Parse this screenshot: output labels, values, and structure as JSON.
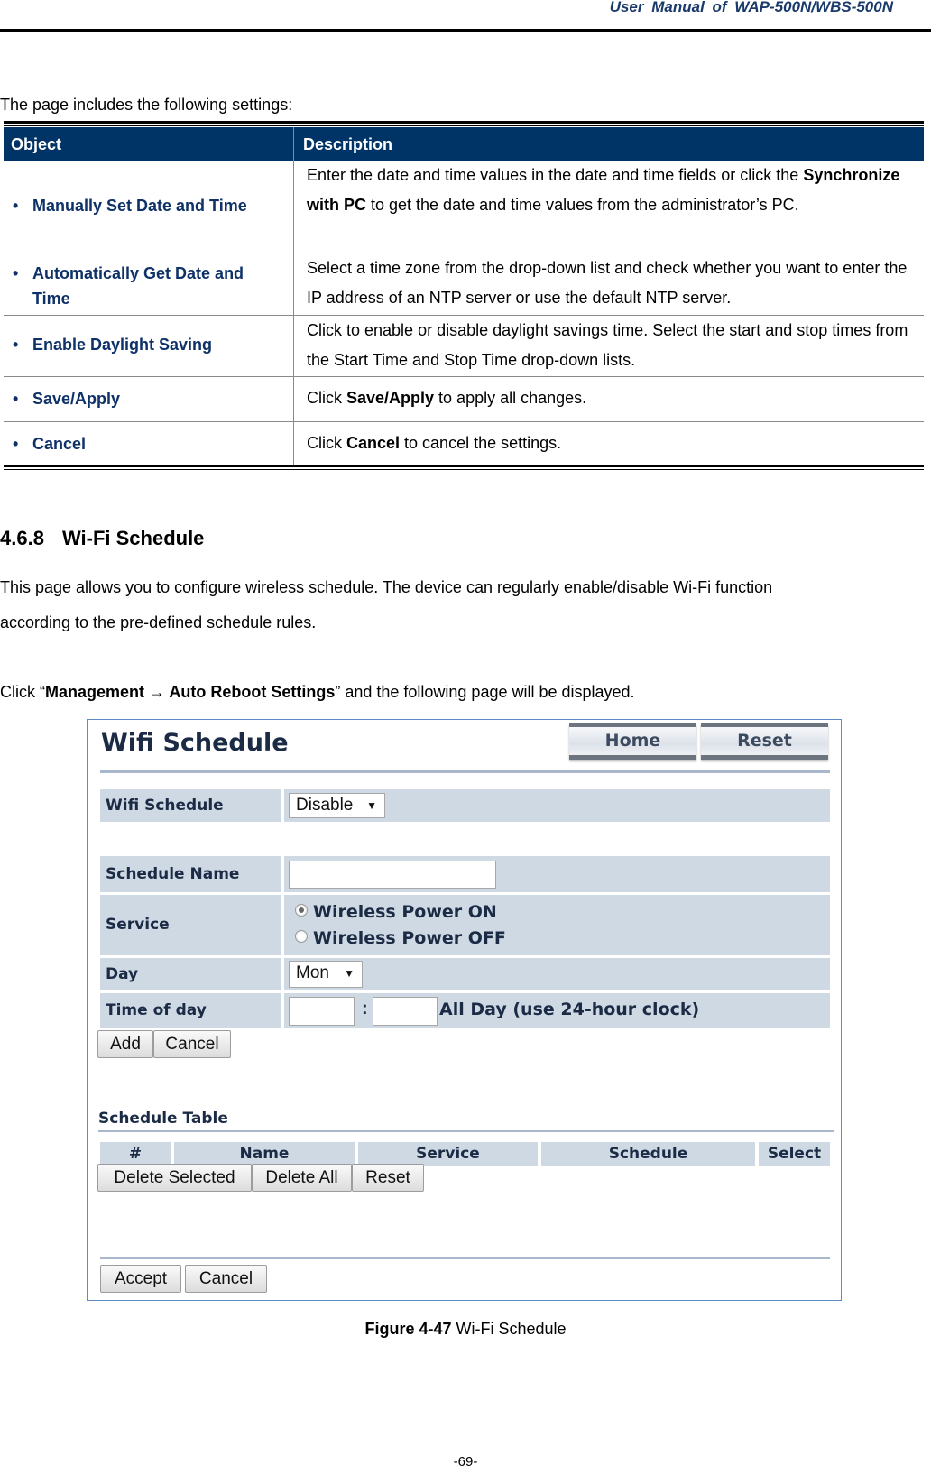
{
  "header": {
    "title": "User  Manual  of  WAP-500N/WBS-500N"
  },
  "intro": "The page includes the following settings:",
  "settings_table": {
    "columns": [
      "Object",
      "Description"
    ],
    "rows": [
      {
        "object": "Manually Set Date and Time",
        "desc_parts": [
          "Enter the date and time values in the date and time fields or click the ",
          "Synchronize with PC",
          " to get the date and time values from the administrator’s PC."
        ]
      },
      {
        "object_line1": "Automatically Get Date and",
        "object_line2": "Time",
        "desc": "Select a time zone from the drop-down list and check whether you want to enter the IP address of an NTP server or use the default NTP server."
      },
      {
        "object": "Enable Daylight Saving",
        "desc": "Click to enable or disable daylight savings time. Select the start and stop times from the Start Time and Stop Time drop-down lists."
      },
      {
        "object": "Save/Apply",
        "desc_parts": [
          "Click ",
          "Save/Apply",
          " to apply all changes."
        ]
      },
      {
        "object": "Cancel",
        "desc_parts": [
          "Click ",
          "Cancel",
          " to cancel the settings."
        ]
      }
    ]
  },
  "section": {
    "number": "4.6.8",
    "title": "Wi-Fi Schedule",
    "paragraph_line1": "This page allows you to configure wireless schedule. The device can regularly enable/disable Wi-Fi function",
    "paragraph_line2": "according to the pre-defined schedule rules.",
    "click_prefix": "Click “",
    "click_path": "Management → Auto Reboot Settings",
    "click_suffix": "” and the following page will be displayed."
  },
  "figure": {
    "title": "Wifi Schedule",
    "nav_buttons": {
      "home": "Home",
      "reset": "Reset"
    },
    "wifi_schedule": {
      "label": "Wifi Schedule",
      "value": "Disable"
    },
    "schedule_name": {
      "label": "Schedule Name",
      "value": ""
    },
    "service": {
      "label": "Service",
      "options": [
        "Wireless Power ON",
        "Wireless Power OFF"
      ],
      "selected": "Wireless Power ON"
    },
    "day": {
      "label": "Day",
      "value": "Mon"
    },
    "time_of_day": {
      "label": "Time of day",
      "separator": ":",
      "hint": "All Day (use 24-hour clock)"
    },
    "form_buttons": {
      "add": "Add",
      "cancel": "Cancel"
    },
    "schedule_table": {
      "caption": "Schedule Table",
      "columns": [
        "#",
        "Name",
        "Service",
        "Schedule",
        "Select"
      ],
      "rows": []
    },
    "table_buttons": {
      "delete_selected": "Delete Selected",
      "delete_all": "Delete All",
      "reset": "Reset"
    },
    "footer_buttons": {
      "accept": "Accept",
      "cancel": "Cancel"
    }
  },
  "caption": {
    "label": "Figure 4-47",
    "text": " Wi-Fi Schedule"
  },
  "page_number": "-69-",
  "colors": {
    "table_header": "#003366",
    "object_text": "#0e3168",
    "form_label_bg": "#cfd9e4",
    "figure_border": "#5b8bc6"
  }
}
